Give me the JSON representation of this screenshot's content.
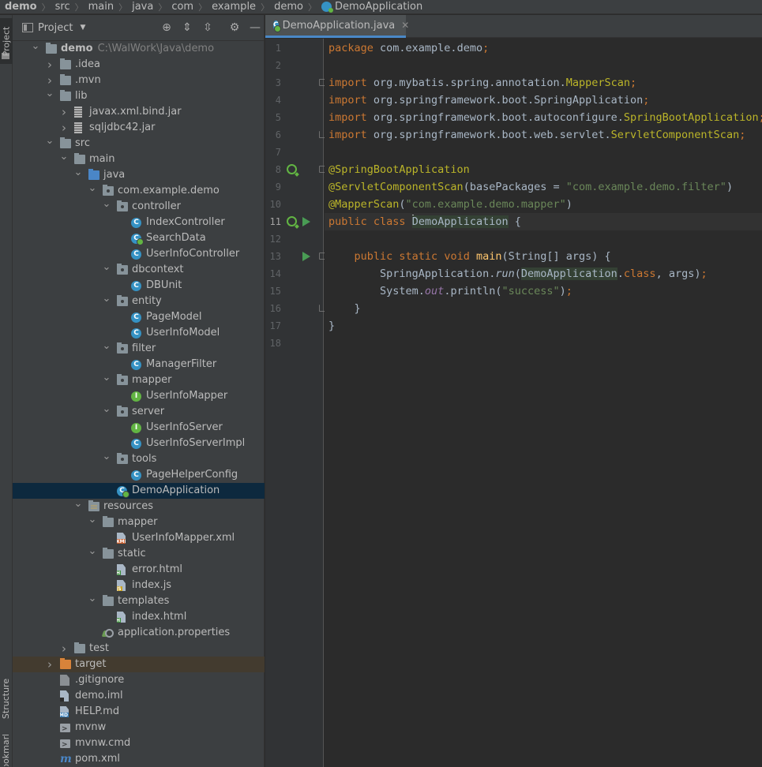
{
  "breadcrumb": [
    {
      "label": "demo"
    },
    {
      "label": "src"
    },
    {
      "label": "main"
    },
    {
      "label": "java"
    },
    {
      "label": "com"
    },
    {
      "label": "example"
    },
    {
      "label": "demo"
    },
    {
      "label": "DemoApplication"
    }
  ],
  "toolwindows": {
    "project": "Project",
    "structure": "Structure",
    "bookmarks": "Bookmarks"
  },
  "project_panel": {
    "title": "Project",
    "tree": [
      {
        "label": "demo",
        "sub": "C:\\WalWork\\Java\\demo",
        "depth": 0,
        "arrow": "down",
        "icon": "module"
      },
      {
        "label": ".idea",
        "depth": 1,
        "arrow": "right",
        "icon": "folder"
      },
      {
        "label": ".mvn",
        "depth": 1,
        "arrow": "right",
        "icon": "folder"
      },
      {
        "label": "lib",
        "depth": 1,
        "arrow": "down",
        "icon": "folder"
      },
      {
        "label": "javax.xml.bind.jar",
        "depth": 2,
        "arrow": "right",
        "icon": "jar"
      },
      {
        "label": "sqljdbc42.jar",
        "depth": 2,
        "arrow": "right",
        "icon": "jar"
      },
      {
        "label": "src",
        "depth": 1,
        "arrow": "down",
        "icon": "folder"
      },
      {
        "label": "main",
        "depth": 2,
        "arrow": "down",
        "icon": "folder"
      },
      {
        "label": "java",
        "depth": 3,
        "arrow": "down",
        "icon": "src-root"
      },
      {
        "label": "com.example.demo",
        "depth": 4,
        "arrow": "down",
        "icon": "pkg"
      },
      {
        "label": "controller",
        "depth": 5,
        "arrow": "down",
        "icon": "pkg"
      },
      {
        "label": "IndexController",
        "depth": 6,
        "icon": "class"
      },
      {
        "label": "SearchData",
        "depth": 6,
        "icon": "boot"
      },
      {
        "label": "UserInfoController",
        "depth": 6,
        "icon": "class"
      },
      {
        "label": "dbcontext",
        "depth": 5,
        "arrow": "down",
        "icon": "pkg"
      },
      {
        "label": "DBUnit",
        "depth": 6,
        "icon": "class"
      },
      {
        "label": "entity",
        "depth": 5,
        "arrow": "down",
        "icon": "pkg"
      },
      {
        "label": "PageModel",
        "depth": 6,
        "icon": "class"
      },
      {
        "label": "UserInfoModel",
        "depth": 6,
        "icon": "class"
      },
      {
        "label": "filter",
        "depth": 5,
        "arrow": "down",
        "icon": "pkg"
      },
      {
        "label": "ManagerFilter",
        "depth": 6,
        "icon": "class"
      },
      {
        "label": "mapper",
        "depth": 5,
        "arrow": "down",
        "icon": "pkg"
      },
      {
        "label": "UserInfoMapper",
        "depth": 6,
        "icon": "interface"
      },
      {
        "label": "server",
        "depth": 5,
        "arrow": "down",
        "icon": "pkg"
      },
      {
        "label": "UserInfoServer",
        "depth": 6,
        "icon": "interface"
      },
      {
        "label": "UserInfoServerImpl",
        "depth": 6,
        "icon": "class"
      },
      {
        "label": "tools",
        "depth": 5,
        "arrow": "down",
        "icon": "pkg"
      },
      {
        "label": "PageHelperConfig",
        "depth": 6,
        "icon": "class"
      },
      {
        "label": "DemoApplication",
        "depth": 5,
        "icon": "boot",
        "selected": true
      },
      {
        "label": "resources",
        "depth": 3,
        "arrow": "down",
        "icon": "res"
      },
      {
        "label": "mapper",
        "depth": 4,
        "arrow": "down",
        "icon": "folder"
      },
      {
        "label": "UserInfoMapper.xml",
        "depth": 5,
        "icon": "xml"
      },
      {
        "label": "static",
        "depth": 4,
        "arrow": "down",
        "icon": "folder"
      },
      {
        "label": "error.html",
        "depth": 5,
        "icon": "html"
      },
      {
        "label": "index.js",
        "depth": 5,
        "icon": "js"
      },
      {
        "label": "templates",
        "depth": 4,
        "arrow": "down",
        "icon": "folder"
      },
      {
        "label": "index.html",
        "depth": 5,
        "icon": "html"
      },
      {
        "label": "application.properties",
        "depth": 4,
        "icon": "props"
      },
      {
        "label": "test",
        "depth": 2,
        "arrow": "right",
        "icon": "folder"
      },
      {
        "label": "target",
        "depth": 1,
        "arrow": "right",
        "icon": "target",
        "excluded": true
      },
      {
        "label": ".gitignore",
        "depth": 1,
        "icon": "gitignore"
      },
      {
        "label": "demo.iml",
        "depth": 1,
        "icon": "iml"
      },
      {
        "label": "HELP.md",
        "depth": 1,
        "icon": "md"
      },
      {
        "label": "mvnw",
        "depth": 1,
        "icon": "term"
      },
      {
        "label": "mvnw.cmd",
        "depth": 1,
        "icon": "term"
      },
      {
        "label": "pom.xml",
        "depth": 1,
        "icon": "maven"
      }
    ]
  },
  "editor": {
    "tab_label": "DemoApplication.java",
    "current_line": 11,
    "lines": [
      [
        {
          "t": "package ",
          "c": "kw"
        },
        {
          "t": "com.example.demo"
        },
        {
          "t": ";",
          "c": "kw"
        }
      ],
      [],
      [
        {
          "t": "import ",
          "c": "kw"
        },
        {
          "t": "org.mybatis.spring.annotation."
        },
        {
          "t": "MapperScan",
          "c": "ann-cls"
        },
        {
          "t": ";",
          "c": "kw"
        }
      ],
      [
        {
          "t": "import ",
          "c": "kw"
        },
        {
          "t": "org.springframework.boot.SpringApplication"
        },
        {
          "t": ";",
          "c": "kw"
        }
      ],
      [
        {
          "t": "import ",
          "c": "kw"
        },
        {
          "t": "org.springframework.boot.autoconfigure."
        },
        {
          "t": "SpringBootApplication",
          "c": "ann-cls"
        },
        {
          "t": ";",
          "c": "kw"
        }
      ],
      [
        {
          "t": "import ",
          "c": "kw"
        },
        {
          "t": "org.springframework.boot.web.servlet."
        },
        {
          "t": "ServletComponentScan",
          "c": "ann-cls"
        },
        {
          "t": ";",
          "c": "kw"
        }
      ],
      [],
      [
        {
          "t": "@SpringBootApplication",
          "c": "an"
        }
      ],
      [
        {
          "t": "@ServletComponentScan",
          "c": "an"
        },
        {
          "t": "(basePackages = "
        },
        {
          "t": "\"com.example.demo.filter\"",
          "c": "st"
        },
        {
          "t": ")"
        }
      ],
      [
        {
          "t": "@MapperScan",
          "c": "an"
        },
        {
          "t": "("
        },
        {
          "t": "\"com.example.demo.mapper\"",
          "c": "st"
        },
        {
          "t": ")"
        }
      ],
      [
        {
          "t": "public ",
          "c": "kw"
        },
        {
          "t": "class ",
          "c": "kw"
        },
        {
          "t": "",
          "c": "caret"
        },
        {
          "t": "DemoApplication",
          "c": "hl"
        },
        {
          "t": " {"
        }
      ],
      [],
      [
        {
          "t": "    "
        },
        {
          "t": "public ",
          "c": "kw"
        },
        {
          "t": "static ",
          "c": "kw"
        },
        {
          "t": "void ",
          "c": "kw"
        },
        {
          "t": "main",
          "c": "fn"
        },
        {
          "t": "(String[] args) {"
        }
      ],
      [
        {
          "t": "        SpringApplication."
        },
        {
          "t": "run",
          "c": "it"
        },
        {
          "t": "("
        },
        {
          "t": "DemoApplication",
          "c": "hl"
        },
        {
          "t": ".",
          "c": ""
        },
        {
          "t": "class",
          "c": "kw"
        },
        {
          "t": ", args)"
        },
        {
          "t": ";",
          "c": "kw"
        }
      ],
      [
        {
          "t": "        System."
        },
        {
          "t": "out",
          "c": "fld"
        },
        {
          "t": ".println("
        },
        {
          "t": "\"success\"",
          "c": "st"
        },
        {
          "t": ")"
        },
        {
          "t": ";",
          "c": "kw"
        }
      ],
      [
        {
          "t": "    }"
        }
      ],
      [
        {
          "t": "}"
        }
      ],
      []
    ]
  }
}
